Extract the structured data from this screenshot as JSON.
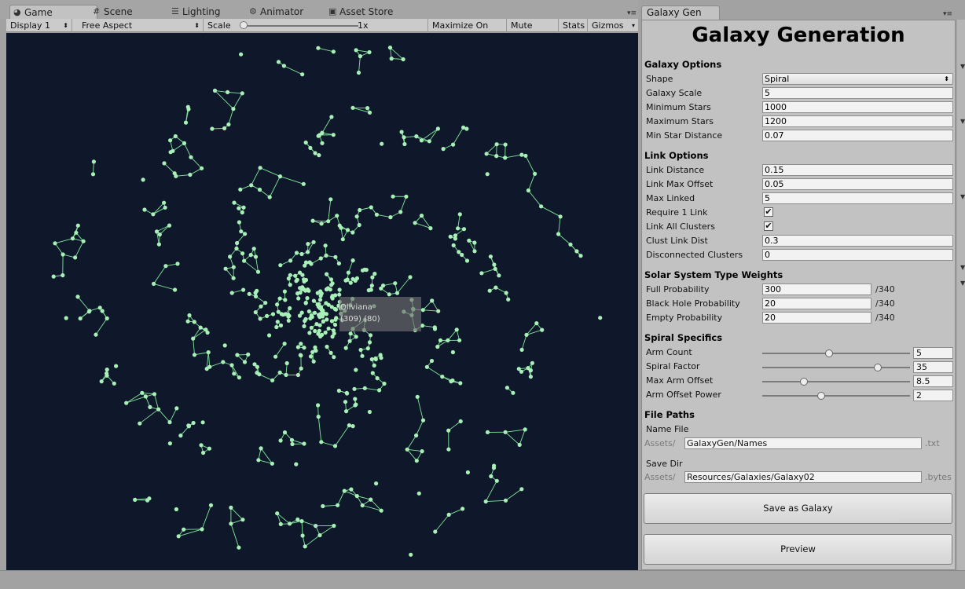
{
  "tabs": [
    {
      "label": "Game",
      "icon": "pacman-icon",
      "active": true
    },
    {
      "label": "Scene",
      "icon": "grid-icon"
    },
    {
      "label": "Lighting",
      "icon": "sliders-icon"
    },
    {
      "label": "Animator",
      "icon": "animator-icon"
    },
    {
      "label": "Asset Store",
      "icon": "store-icon"
    }
  ],
  "toolbar": {
    "display": "Display 1",
    "aspect": "Free Aspect",
    "scale_label": "Scale",
    "scale_value": "1x",
    "maximize": "Maximize On Play",
    "mute": "Mute Audio",
    "stats": "Stats",
    "gizmos": "Gizmos"
  },
  "colors": {
    "game_bg": "#0f182a",
    "star": "#a8f0b8",
    "link": "#7fe69a",
    "panel": "#c2c2c2"
  },
  "tooltip": {
    "name": "Oliviana",
    "coords": "(309) (80)"
  },
  "inspector": {
    "tab_label": "Galaxy Gen",
    "title": "Galaxy Generation",
    "galaxy_options": {
      "heading": "Galaxy Options",
      "shape_label": "Shape",
      "shape_value": "Spiral",
      "scale_label": "Galaxy Scale",
      "scale_value": "5",
      "min_stars_label": "Minimum Stars",
      "min_stars_value": "1000",
      "max_stars_label": "Maximum Stars",
      "max_stars_value": "1200",
      "min_dist_label": "Min Star Distance",
      "min_dist_value": "0.07"
    },
    "link_options": {
      "heading": "Link Options",
      "link_dist_label": "Link Distance",
      "link_dist_value": "0.15",
      "max_offset_label": "Link Max Offset",
      "max_offset_value": "0.05",
      "max_linked_label": "Max Linked",
      "max_linked_value": "5",
      "req1_label": "Require 1 Link",
      "req1_checked": true,
      "all_clusters_label": "Link All Clusters",
      "all_clusters_checked": true,
      "clust_dist_label": "Clust Link Dist",
      "clust_dist_value": "0.3",
      "disconnected_label": "Disconnected Clusters",
      "disconnected_value": "0"
    },
    "weights": {
      "heading": "Solar System Type Weights",
      "full_label": "Full Probability",
      "full_value": "300",
      "black_label": "Black Hole Probability",
      "black_value": "20",
      "empty_label": "Empty Probability",
      "empty_value": "20",
      "total": "/340"
    },
    "spiral": {
      "heading": "Spiral Specifics",
      "arm_count_label": "Arm Count",
      "arm_count_value": "5",
      "arm_count_fraction": 0.45,
      "spiral_factor_label": "Spiral Factor",
      "spiral_factor_value": "35",
      "spiral_factor_fraction": 0.78,
      "max_arm_offset_label": "Max Arm Offset",
      "max_arm_offset_value": "8.5",
      "max_arm_offset_fraction": 0.28,
      "arm_power_label": "Arm Offset Power",
      "arm_power_value": "2",
      "arm_power_fraction": 0.4
    },
    "file_paths": {
      "heading": "File Paths",
      "name_file_label": "Name File",
      "assets_prefix": "Assets/",
      "name_file_value": "GalaxyGen/Names",
      "name_file_ext": ".txt",
      "save_dir_label": "Save Dir",
      "save_dir_value": "Resources/Galaxies/Galaxy02",
      "save_dir_ext": ".bytes"
    },
    "save_button": "Save as Galaxy",
    "preview_button": "Preview"
  }
}
